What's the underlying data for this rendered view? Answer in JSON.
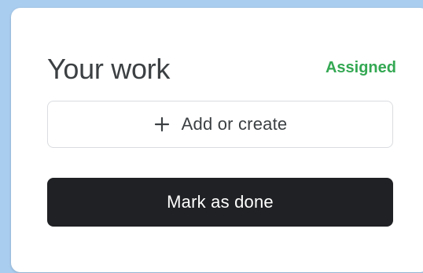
{
  "your_work": {
    "title": "Your work",
    "status": "Assigned",
    "add_button": {
      "label": "Add or create",
      "icon": "plus-icon"
    },
    "done_button": {
      "label": "Mark as done"
    }
  },
  "colors": {
    "status_green": "#34a853",
    "done_button_bg": "#202124",
    "text_dark": "#3c4043"
  }
}
